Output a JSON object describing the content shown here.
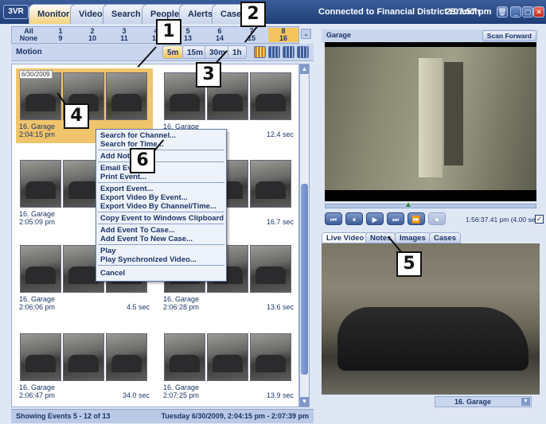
{
  "app": {
    "logo": "3VR"
  },
  "tabs": [
    "Monitor",
    "Video",
    "Search",
    "People",
    "Alerts",
    "Cases"
  ],
  "header": {
    "connection": "Connected to Financial District Branch",
    "time": "2:07:57 pm"
  },
  "window_buttons": {
    "trash": "🗑",
    "minimize": "_",
    "restore": "▢",
    "close": "✕"
  },
  "channels": [
    {
      "top": "All",
      "bottom": "None"
    },
    {
      "top": "1",
      "bottom": "9"
    },
    {
      "top": "2",
      "bottom": "10"
    },
    {
      "top": "3",
      "bottom": "11"
    },
    {
      "top": "4",
      "bottom": "12"
    },
    {
      "top": "5",
      "bottom": "13"
    },
    {
      "top": "6",
      "bottom": "14"
    },
    {
      "top": "7",
      "bottom": "15"
    },
    {
      "top": "8",
      "bottom": "16"
    }
  ],
  "filter": {
    "label": "Motion",
    "durations": [
      "5m",
      "15m",
      "30m",
      "1h"
    ],
    "selected_duration": "5m"
  },
  "events": [
    {
      "date": "6/30/2009",
      "channel": "16. Garage",
      "time": "2:04:15 pm",
      "duration": ""
    },
    {
      "channel": "16. Garage",
      "time": "",
      "duration": "12.4 sec"
    },
    {
      "channel": "16. Garage",
      "time": "2:05:09 pm",
      "duration": ""
    },
    {
      "channel": "",
      "time": "",
      "duration": "16.7 sec"
    },
    {
      "channel": "16. Garage",
      "time": "2:06:06 pm",
      "duration": "4.5 sec"
    },
    {
      "channel": "16. Garage",
      "time": "2:06:28 pm",
      "duration": "13.6 sec"
    },
    {
      "channel": "16. Garage",
      "time": "2:06:47 pm",
      "duration": "34.0 sec"
    },
    {
      "channel": "16. Garage",
      "time": "2:07:25 pm",
      "duration": "13.9 sec"
    }
  ],
  "context_menu": [
    "Search for Channel...",
    "Search for Time...",
    "Add Note...",
    "Email Event...",
    "Print Event...",
    "Export Event...",
    "Export Video By Event...",
    "Export Video By Channel/Time...",
    "Copy Event to Windows Clipboard",
    "Add Event To Case...",
    "Add Event To New Case...",
    "Play",
    "Play Synchronized Video...",
    "Cancel"
  ],
  "status": {
    "left": "Showing Events 5 - 12 of 13",
    "right": "Tuesday 6/30/2009, 2:04:15 pm - 2:07:39 pm"
  },
  "playback": {
    "camera": "Garage",
    "scan_label": "Scan Forward",
    "time": "1:56:37.41 pm (4.00 sec)"
  },
  "playback_controls": [
    "⏮",
    "⏸",
    "▶",
    "⏭",
    "⏩",
    "⏺"
  ],
  "right_tabs": [
    "Live Video",
    "Notes",
    "Images",
    "Cases"
  ],
  "live": {
    "camera": "16. Garage"
  },
  "callouts": [
    "1",
    "2",
    "3",
    "4",
    "5",
    "6"
  ]
}
